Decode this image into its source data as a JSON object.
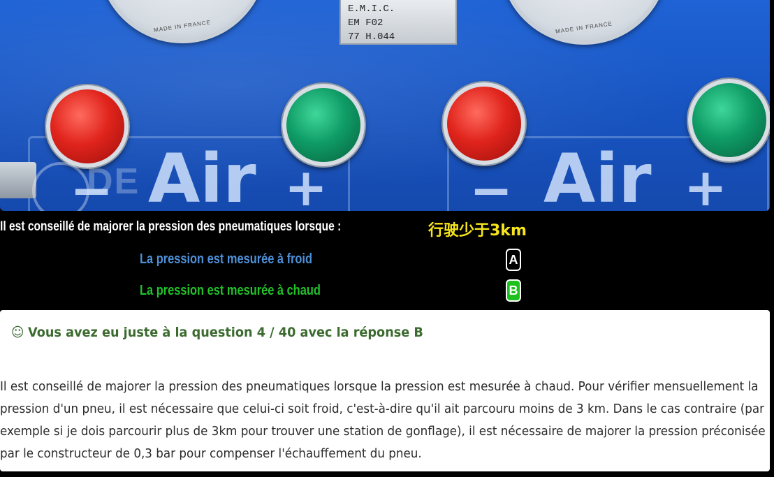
{
  "photo": {
    "gauge_text_left": "MADE IN FRANCE",
    "gauge_text_right": "MADE IN FRANCE",
    "plate_lines": [
      "E.M.I.C.",
      "EM F02",
      "77 H.044"
    ],
    "air_label_left": "Air",
    "air_label_right": "Air",
    "minus": "−",
    "plus": "+",
    "watermark": "DE"
  },
  "question": {
    "text": "Il est conseillé de majorer la pression des pneumatiques lorsque :",
    "hint": "行驶少于3km"
  },
  "answers": [
    {
      "text": "La pression est mesurée à froid",
      "letter": "A",
      "color": "#4e8fd8"
    },
    {
      "text": "La pression est mesurée à chaud",
      "letter": "B",
      "color": "#22c22a"
    }
  ],
  "result": {
    "icon": "smile-icon",
    "title": "Vous avez eu juste à la question 4 / 40 avec la réponse B",
    "explanation": "Il est conseillé de majorer la pression des pneumatiques lorsque la pression est mesurée à chaud. Pour vérifier mensuellement la pression d'un pneu, il est nécessaire que celui-ci soit froid, c'est-à-dire qu'il ait parcouru moins de 3 km. Dans le cas contraire (par exemple si je dois parcourir plus de 3km pour trouver une station de gonflage), il est nécessaire de majorer la pression préconisée par le constructeur de 0,3 bar pour compenser l'échauffement du pneu."
  },
  "colors": {
    "selected_green": "#1dc01d",
    "hint_yellow": "#f6e51b",
    "result_title": "#3b6b2f"
  }
}
